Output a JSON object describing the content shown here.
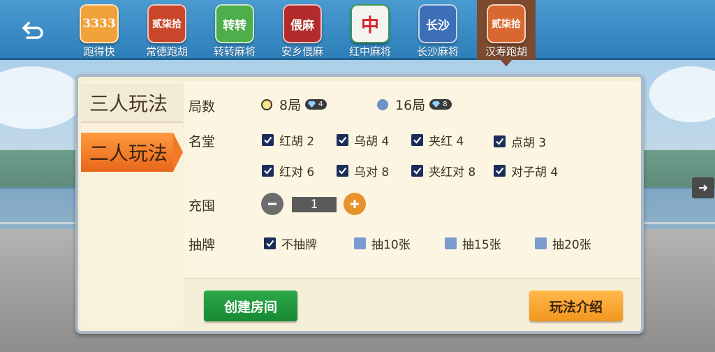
{
  "top_nav": {
    "games": [
      {
        "label": "跑得快",
        "icon": "paodekuai-icon",
        "icon_text": "3333",
        "color": "#f2a23a"
      },
      {
        "label": "常德跑胡",
        "icon": "changde-paohu-icon",
        "icon_text": "贰柒拾",
        "color": "#c9462b"
      },
      {
        "label": "转转麻将",
        "icon": "zhuanzhuan-mahjong-icon",
        "icon_text": "转转",
        "color": "#4fae4c"
      },
      {
        "label": "安乡偎麻",
        "icon": "anxiang-weima-icon",
        "icon_text": "偎麻",
        "color": "#b22c2c"
      },
      {
        "label": "红中麻将",
        "icon": "hongzhong-mahjong-icon",
        "icon_text": "中",
        "color": "#3a9a52"
      },
      {
        "label": "长沙麻将",
        "icon": "changsha-mahjong-icon",
        "icon_text": "长沙",
        "color": "#3d6fb8"
      },
      {
        "label": "汉寿跑胡",
        "icon": "hanshou-paohu-icon",
        "icon_text": "贰柒拾",
        "color": "#d8682f"
      }
    ],
    "active_index": 6
  },
  "sidebar": {
    "tabs": [
      {
        "label": "三人玩法",
        "active": false
      },
      {
        "label": "二人玩法",
        "active": true
      }
    ]
  },
  "settings": {
    "rounds": {
      "label": "局数",
      "options": [
        {
          "label": "8局",
          "cost": "4",
          "selected": true
        },
        {
          "label": "16局",
          "cost": "8",
          "selected": false
        }
      ]
    },
    "mingtang": {
      "label": "名堂",
      "options": [
        {
          "label": "红胡 2",
          "checked": true
        },
        {
          "label": "乌胡 4",
          "checked": true
        },
        {
          "label": "夹红 4",
          "checked": true
        },
        {
          "label": "点胡 3",
          "checked": true
        },
        {
          "label": "红对 6",
          "checked": true
        },
        {
          "label": "乌对 8",
          "checked": true
        },
        {
          "label": "夹红对 8",
          "checked": true
        },
        {
          "label": "对子胡 4",
          "checked": true
        }
      ]
    },
    "chongqiu": {
      "label": "充囤",
      "value": "1"
    },
    "draw": {
      "label": "抽牌",
      "options": [
        {
          "label": "不抽牌",
          "checked": true
        },
        {
          "label": "抽10张",
          "checked": false
        },
        {
          "label": "抽15张",
          "checked": false
        },
        {
          "label": "抽20张",
          "checked": false
        }
      ]
    }
  },
  "buttons": {
    "create_room": "创建房间",
    "rules_intro": "玩法介绍"
  },
  "colors": {
    "top_bar": "#2e7fb9",
    "active_tab": "#e8661a",
    "panel_bg": "#f6efd8",
    "create_button": "#178a33",
    "rules_button": "#f2961f"
  }
}
